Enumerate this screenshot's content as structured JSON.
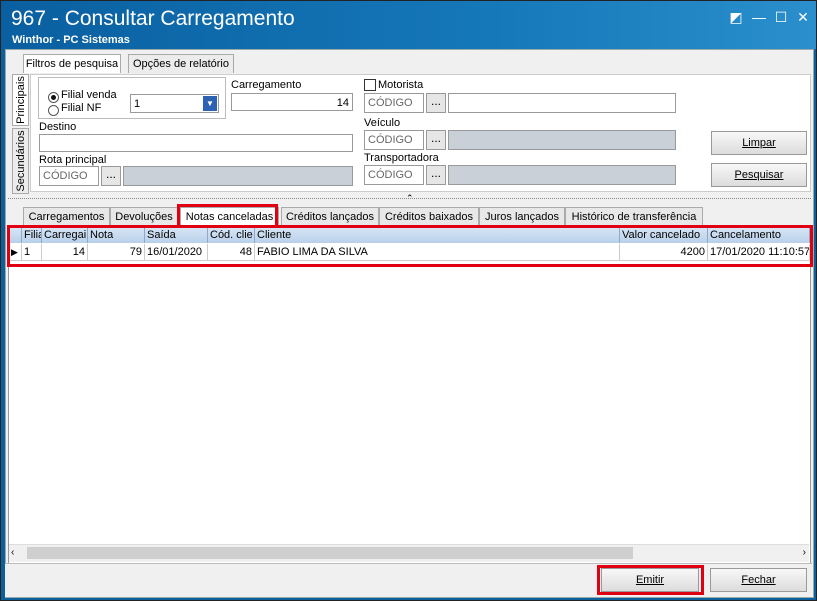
{
  "window": {
    "title": "967 - Consultar Carregamento",
    "subtitle": "Winthor - PC Sistemas",
    "controls": {
      "restore": "◩",
      "minimize": "—",
      "maximize": "☐",
      "close": "✕"
    }
  },
  "top_tabs": [
    "Filtros de pesquisa",
    "Opções de relatório"
  ],
  "side_tabs": [
    "Principais",
    "Secundários"
  ],
  "filters": {
    "filial_venda_label": "Filial venda",
    "filial_nf_label": "Filial NF",
    "filial_value": "1",
    "carregamento_label": "Carregamento",
    "carregamento_value": "14",
    "motorista_label": "Motorista",
    "motorista_code": "CÓDIGO",
    "destino_label": "Destino",
    "veiculo_label": "Veículo",
    "veiculo_code": "CÓDIGO",
    "rota_label": "Rota principal",
    "rota_code": "CÓDIGO",
    "transportadora_label": "Transportadora",
    "transportadora_code": "CÓDIGO",
    "dots": "...",
    "limpar": "Limpar",
    "pesquisar": "Pesquisar"
  },
  "result_tabs": [
    "Carregamentos",
    "Devoluções",
    "Notas canceladas",
    "Créditos lançados",
    "Créditos baixados",
    "Juros lançados",
    "Histórico de transferência"
  ],
  "grid": {
    "headers": [
      "Filia",
      "Carregai",
      "Nota",
      "Saída",
      "Cód. clie",
      "Cliente",
      "Valor cancelado",
      "Cancelamento"
    ],
    "rows": [
      [
        "1",
        "14",
        "79",
        "16/01/2020",
        "48",
        "FABIO LIMA DA SILVA",
        "4200",
        "17/01/2020 11:10:57"
      ]
    ]
  },
  "footer": {
    "emitir": "Emitir",
    "fechar": "Fechar"
  },
  "colors": {
    "titlebar": "#0a5fa0",
    "highlight": "#e00012",
    "grid_header": "#c6d9ef"
  }
}
